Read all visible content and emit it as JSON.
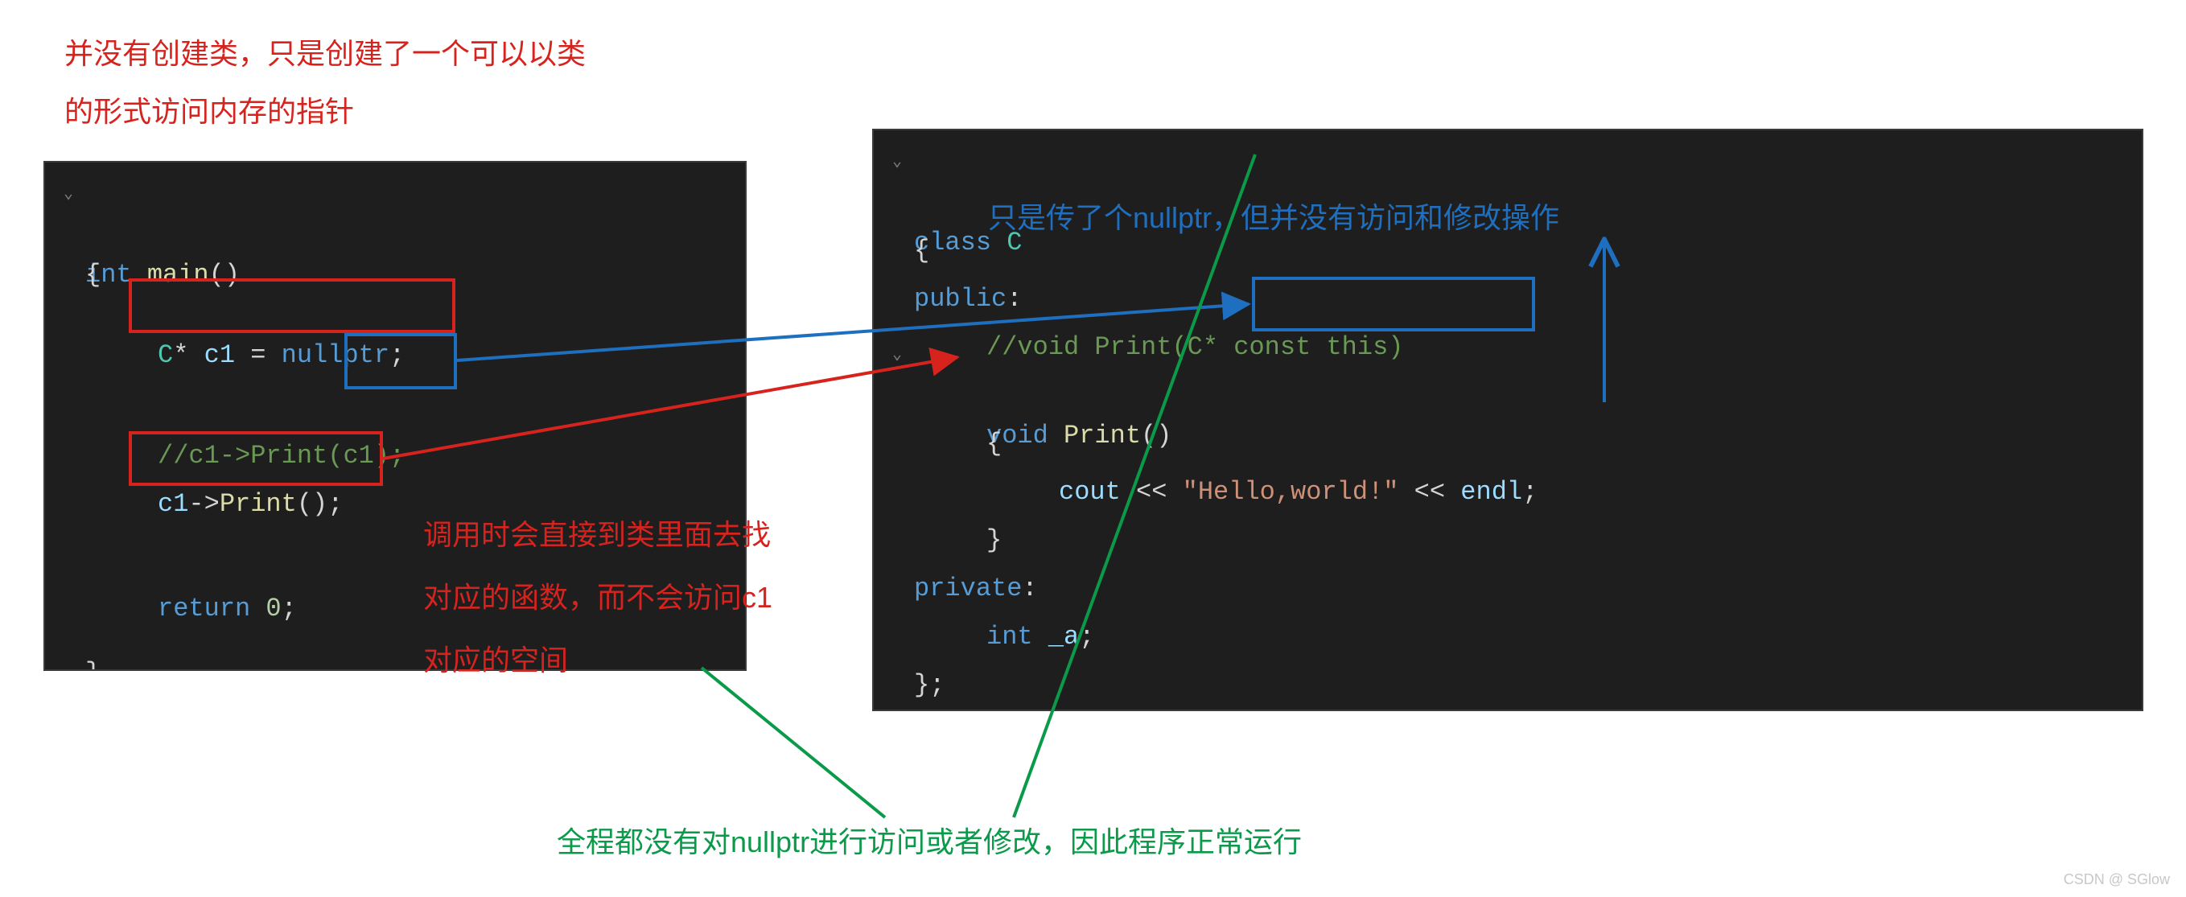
{
  "annotations": {
    "top_red_l1": "并没有创建类，只是创建了一个可以以类",
    "top_red_l2": "的形式访问内存的指针",
    "mid_red_l1": "调用时会直接到类里面去找",
    "mid_red_l2": "对应的函数，而不会访问c1",
    "mid_red_l3": "对应的空间",
    "right_blue": "只是传了个nullptr，但并没有访问和修改操作",
    "bottom_green": "全程都没有对nullptr进行访问或者修改，因此程序正常运行"
  },
  "left_code": {
    "l0_kw": "int",
    "l0_fn": " main",
    "l0_rest": "()",
    "l1": "{",
    "l2_type": "C",
    "l2_ptr": "*",
    "l2_var": " c1",
    "l2_eq": " = ",
    "l2_kw": "nullptr",
    "l2_sc": ";",
    "l3_cmt": "//c1->Print(c1);",
    "l4_var": "c1",
    "l4_arrow": "->",
    "l4_fn": "Print",
    "l4_rest": "();",
    "l5_kw": "return",
    "l5_num": " 0",
    "l5_sc": ";",
    "l6": "}"
  },
  "right_code": {
    "r0_kw": "class",
    "r0_type": " C",
    "r1": "{",
    "r2_kw": "public",
    "r2_colon": ":",
    "r3_cmt_a": "//void Print(",
    "r3_cmt_b": "C* const this",
    "r3_cmt_c": ")",
    "r4_kw": "void",
    "r4_fn": " Print",
    "r4_rest": "()",
    "r5": "{",
    "r6_cout": "cout",
    "r6_op1": " << ",
    "r6_str": "\"Hello,world!\"",
    "r6_op2": " << ",
    "r6_endl": "endl",
    "r6_sc": ";",
    "r7": "}",
    "r8_kw": "private",
    "r8_colon": ":",
    "r9_kw": "int",
    "r9_var": " _a",
    "r9_sc": ";",
    "r10": "};"
  },
  "watermark": "CSDN @ SGlow"
}
